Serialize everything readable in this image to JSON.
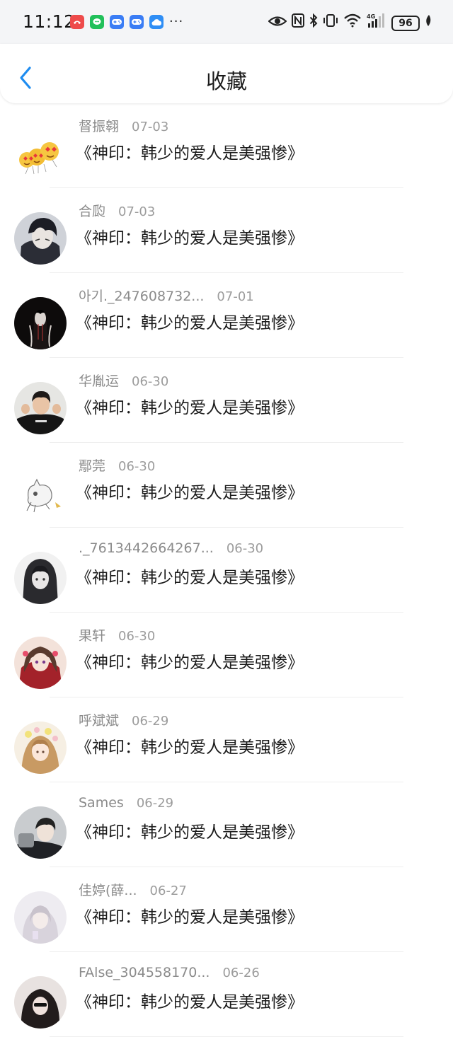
{
  "status_bar": {
    "time": "11:12",
    "notification_icons": [
      "missed-call-icon",
      "message-icon",
      "game-controller-icon",
      "game-controller-icon",
      "cloud-icon"
    ],
    "more_indicator": "···",
    "system_icons": [
      "eye-icon",
      "nfc-icon",
      "bluetooth-icon",
      "vibrate-icon",
      "wifi-icon",
      "signal-4g-icon"
    ],
    "network_label": "4G",
    "battery_level": "96"
  },
  "header": {
    "back_icon": "chevron-left-icon",
    "title": "收藏",
    "accent_color": "#1e8cf0"
  },
  "favorites": [
    {
      "name": "督振翱",
      "date": "07-03",
      "title": "《神印：韩少的爱人是美强惨》",
      "avatar": "emoji-hearts"
    },
    {
      "name": "合瓝",
      "date": "07-03",
      "title": "《神印：韩少的爱人是美强惨》",
      "avatar": "anime-boy-dark"
    },
    {
      "name": "아기._247608732...",
      "date": "07-01",
      "title": "《神印：韩少的爱人是美强惨》",
      "avatar": "dark-portrait"
    },
    {
      "name": "华胤运",
      "date": "06-30",
      "title": "《神印：韩少的爱人是美强惨》",
      "avatar": "photo-boy"
    },
    {
      "name": "鄢莞",
      "date": "06-30",
      "title": "《神印：韩少的爱人是美强惨》",
      "avatar": "white-cat-sketch"
    },
    {
      "name": "._7613442664267...",
      "date": "06-30",
      "title": "《神印：韩少的爱人是美强惨》",
      "avatar": "anime-hooded"
    },
    {
      "name": "果轩",
      "date": "06-30",
      "title": "《神印：韩少的爱人是美强惨》",
      "avatar": "anime-girl-red"
    },
    {
      "name": "呼斌斌",
      "date": "06-29",
      "title": "《神印：韩少的爱人是美强惨》",
      "avatar": "anime-girl-flowers"
    },
    {
      "name": "Sames",
      "date": "06-29",
      "title": "《神印：韩少的爱人是美强惨》",
      "avatar": "photo-man"
    },
    {
      "name": "佳婷(薛...",
      "date": "06-27",
      "title": "《神印：韩少的爱人是美强惨》",
      "avatar": "photo-light-girl"
    },
    {
      "name": "FAlse_304558170...",
      "date": "06-26",
      "title": "《神印：韩少的爱人是美强惨》",
      "avatar": "photo-dark-girl"
    }
  ]
}
